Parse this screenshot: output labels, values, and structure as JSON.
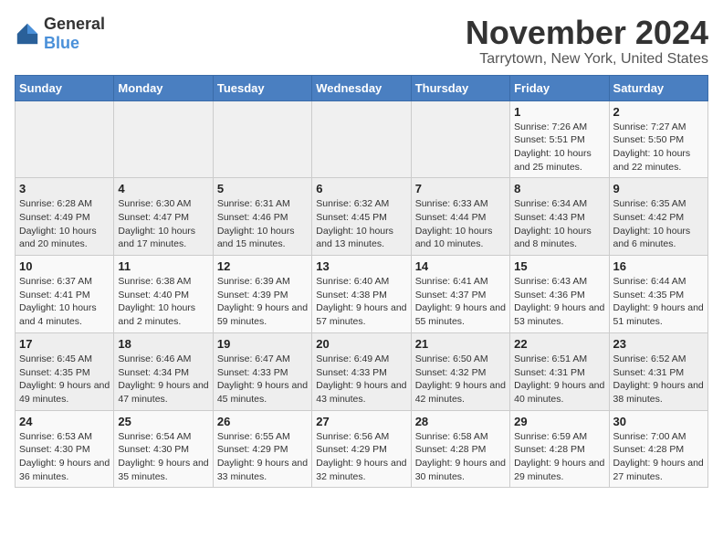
{
  "logo": {
    "general": "General",
    "blue": "Blue"
  },
  "title": "November 2024",
  "location": "Tarrytown, New York, United States",
  "weekdays": [
    "Sunday",
    "Monday",
    "Tuesday",
    "Wednesday",
    "Thursday",
    "Friday",
    "Saturday"
  ],
  "weeks": [
    [
      {
        "day": "",
        "info": ""
      },
      {
        "day": "",
        "info": ""
      },
      {
        "day": "",
        "info": ""
      },
      {
        "day": "",
        "info": ""
      },
      {
        "day": "",
        "info": ""
      },
      {
        "day": "1",
        "info": "Sunrise: 7:26 AM\nSunset: 5:51 PM\nDaylight: 10 hours and 25 minutes."
      },
      {
        "day": "2",
        "info": "Sunrise: 7:27 AM\nSunset: 5:50 PM\nDaylight: 10 hours and 22 minutes."
      }
    ],
    [
      {
        "day": "3",
        "info": "Sunrise: 6:28 AM\nSunset: 4:49 PM\nDaylight: 10 hours and 20 minutes."
      },
      {
        "day": "4",
        "info": "Sunrise: 6:30 AM\nSunset: 4:47 PM\nDaylight: 10 hours and 17 minutes."
      },
      {
        "day": "5",
        "info": "Sunrise: 6:31 AM\nSunset: 4:46 PM\nDaylight: 10 hours and 15 minutes."
      },
      {
        "day": "6",
        "info": "Sunrise: 6:32 AM\nSunset: 4:45 PM\nDaylight: 10 hours and 13 minutes."
      },
      {
        "day": "7",
        "info": "Sunrise: 6:33 AM\nSunset: 4:44 PM\nDaylight: 10 hours and 10 minutes."
      },
      {
        "day": "8",
        "info": "Sunrise: 6:34 AM\nSunset: 4:43 PM\nDaylight: 10 hours and 8 minutes."
      },
      {
        "day": "9",
        "info": "Sunrise: 6:35 AM\nSunset: 4:42 PM\nDaylight: 10 hours and 6 minutes."
      }
    ],
    [
      {
        "day": "10",
        "info": "Sunrise: 6:37 AM\nSunset: 4:41 PM\nDaylight: 10 hours and 4 minutes."
      },
      {
        "day": "11",
        "info": "Sunrise: 6:38 AM\nSunset: 4:40 PM\nDaylight: 10 hours and 2 minutes."
      },
      {
        "day": "12",
        "info": "Sunrise: 6:39 AM\nSunset: 4:39 PM\nDaylight: 9 hours and 59 minutes."
      },
      {
        "day": "13",
        "info": "Sunrise: 6:40 AM\nSunset: 4:38 PM\nDaylight: 9 hours and 57 minutes."
      },
      {
        "day": "14",
        "info": "Sunrise: 6:41 AM\nSunset: 4:37 PM\nDaylight: 9 hours and 55 minutes."
      },
      {
        "day": "15",
        "info": "Sunrise: 6:43 AM\nSunset: 4:36 PM\nDaylight: 9 hours and 53 minutes."
      },
      {
        "day": "16",
        "info": "Sunrise: 6:44 AM\nSunset: 4:35 PM\nDaylight: 9 hours and 51 minutes."
      }
    ],
    [
      {
        "day": "17",
        "info": "Sunrise: 6:45 AM\nSunset: 4:35 PM\nDaylight: 9 hours and 49 minutes."
      },
      {
        "day": "18",
        "info": "Sunrise: 6:46 AM\nSunset: 4:34 PM\nDaylight: 9 hours and 47 minutes."
      },
      {
        "day": "19",
        "info": "Sunrise: 6:47 AM\nSunset: 4:33 PM\nDaylight: 9 hours and 45 minutes."
      },
      {
        "day": "20",
        "info": "Sunrise: 6:49 AM\nSunset: 4:33 PM\nDaylight: 9 hours and 43 minutes."
      },
      {
        "day": "21",
        "info": "Sunrise: 6:50 AM\nSunset: 4:32 PM\nDaylight: 9 hours and 42 minutes."
      },
      {
        "day": "22",
        "info": "Sunrise: 6:51 AM\nSunset: 4:31 PM\nDaylight: 9 hours and 40 minutes."
      },
      {
        "day": "23",
        "info": "Sunrise: 6:52 AM\nSunset: 4:31 PM\nDaylight: 9 hours and 38 minutes."
      }
    ],
    [
      {
        "day": "24",
        "info": "Sunrise: 6:53 AM\nSunset: 4:30 PM\nDaylight: 9 hours and 36 minutes."
      },
      {
        "day": "25",
        "info": "Sunrise: 6:54 AM\nSunset: 4:30 PM\nDaylight: 9 hours and 35 minutes."
      },
      {
        "day": "26",
        "info": "Sunrise: 6:55 AM\nSunset: 4:29 PM\nDaylight: 9 hours and 33 minutes."
      },
      {
        "day": "27",
        "info": "Sunrise: 6:56 AM\nSunset: 4:29 PM\nDaylight: 9 hours and 32 minutes."
      },
      {
        "day": "28",
        "info": "Sunrise: 6:58 AM\nSunset: 4:28 PM\nDaylight: 9 hours and 30 minutes."
      },
      {
        "day": "29",
        "info": "Sunrise: 6:59 AM\nSunset: 4:28 PM\nDaylight: 9 hours and 29 minutes."
      },
      {
        "day": "30",
        "info": "Sunrise: 7:00 AM\nSunset: 4:28 PM\nDaylight: 9 hours and 27 minutes."
      }
    ]
  ]
}
